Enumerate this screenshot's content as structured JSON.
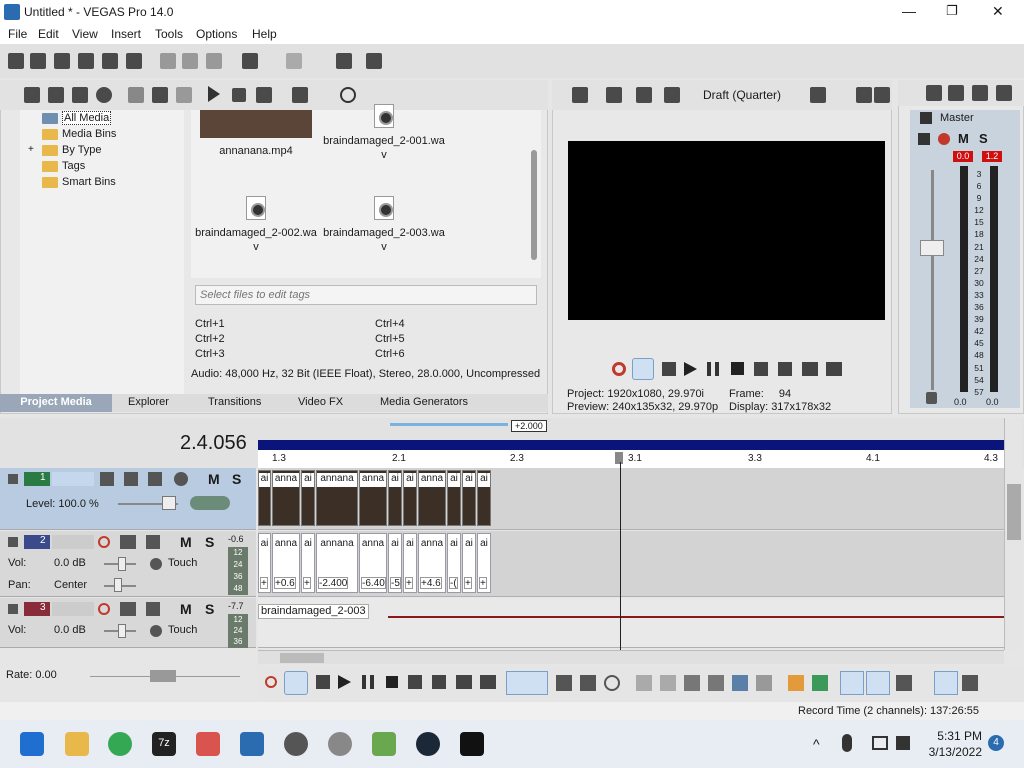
{
  "window": {
    "title": "Untitled * - VEGAS Pro 14.0",
    "minimize": "—",
    "maximize": "❐",
    "close": "✕"
  },
  "menu": [
    "File",
    "Edit",
    "View",
    "Insert",
    "Tools",
    "Options",
    "Help"
  ],
  "explorer": {
    "tree": [
      "All Media",
      "Media Bins",
      "By Type",
      "Tags",
      "Smart Bins"
    ],
    "expand_glyph": "+",
    "files": [
      {
        "name": "annanana.mp4"
      },
      {
        "name": "braindamaged_2-001.wa\nv"
      },
      {
        "name": "braindamaged_2-002.wa\nv"
      },
      {
        "name": "braindamaged_2-003.wa\nv"
      }
    ],
    "tags_placeholder": "Select files to edit tags",
    "shortcuts": [
      "Ctrl+1",
      "Ctrl+2",
      "Ctrl+3",
      "Ctrl+4",
      "Ctrl+5",
      "Ctrl+6"
    ],
    "info": "Audio: 48,000 Hz, 32 Bit (IEEE Float), Stereo, 28.0.000, Uncompressed"
  },
  "tabs": [
    "Project Media",
    "Explorer",
    "Transitions",
    "Video FX",
    "Media Generators"
  ],
  "preview": {
    "quality": "Draft (Quarter)",
    "project_label": "Project:",
    "project": "1920x1080, 29.970i",
    "preview_label": "Preview:",
    "preview": "240x135x32, 29.970p",
    "frame_label": "Frame:",
    "frame": "94",
    "display_label": "Display:",
    "display": "317x178x32"
  },
  "mixer": {
    "title": "Master",
    "m": "M",
    "s": "S",
    "peak_l": "0.0",
    "peak_r": "1.2",
    "scale": [
      "3",
      "6",
      "9",
      "12",
      "15",
      "18",
      "21",
      "24",
      "27",
      "30",
      "33",
      "36",
      "39",
      "42",
      "45",
      "48",
      "51",
      "54",
      "57"
    ],
    "level_l": "0.0",
    "level_r": "0.0"
  },
  "timeline": {
    "timecode": "2.4.056",
    "zoom_badge": "+2.000",
    "ruler": [
      "1.3",
      "2.1",
      "2.3",
      "3.1",
      "3.3",
      "4.1",
      "4.3"
    ],
    "rate": "Rate: 0.00",
    "tracks": [
      {
        "num": "1",
        "m": "M",
        "s": "S",
        "level": "Level: 100.0 %"
      },
      {
        "num": "2",
        "m": "M",
        "s": "S",
        "db": "-0.6",
        "vol_label": "Vol:",
        "vol": "0.0 dB",
        "pan_label": "Pan:",
        "pan": "Center",
        "mode": "Touch",
        "meter": [
          "12",
          "24",
          "36",
          "48"
        ]
      },
      {
        "num": "3",
        "m": "M",
        "s": "S",
        "db": "-7.7",
        "vol_label": "Vol:",
        "vol": "0.0 dB",
        "mode": "Touch",
        "meter": [
          "12",
          "24",
          "36"
        ]
      }
    ],
    "video_clips": [
      "ai",
      "anna",
      "ai",
      "annana",
      "anna",
      "ai",
      "ai",
      "anna",
      "ai",
      "ai",
      "ai"
    ],
    "audio_clips": [
      {
        "label": "ai",
        "val": "+"
      },
      {
        "label": "anna",
        "val": "+0.6"
      },
      {
        "label": "ai",
        "val": "+"
      },
      {
        "label": "annana",
        "val": "-2.400"
      },
      {
        "label": "anna",
        "val": "-6.40"
      },
      {
        "label": "ai",
        "val": "-5"
      },
      {
        "label": "ai",
        "val": "+"
      },
      {
        "label": "anna",
        "val": "+4.6"
      },
      {
        "label": "ai",
        "val": "-("
      },
      {
        "label": "ai",
        "val": "+"
      },
      {
        "label": "ai",
        "val": "+"
      }
    ],
    "track3_clip": "braindamaged_2-003"
  },
  "status": {
    "record_time": "Record Time (2 channels): 137:26:55"
  },
  "taskbar": {
    "time": "5:31 PM",
    "date": "3/13/2022",
    "notif": "4",
    "sevenzip": "7z"
  }
}
